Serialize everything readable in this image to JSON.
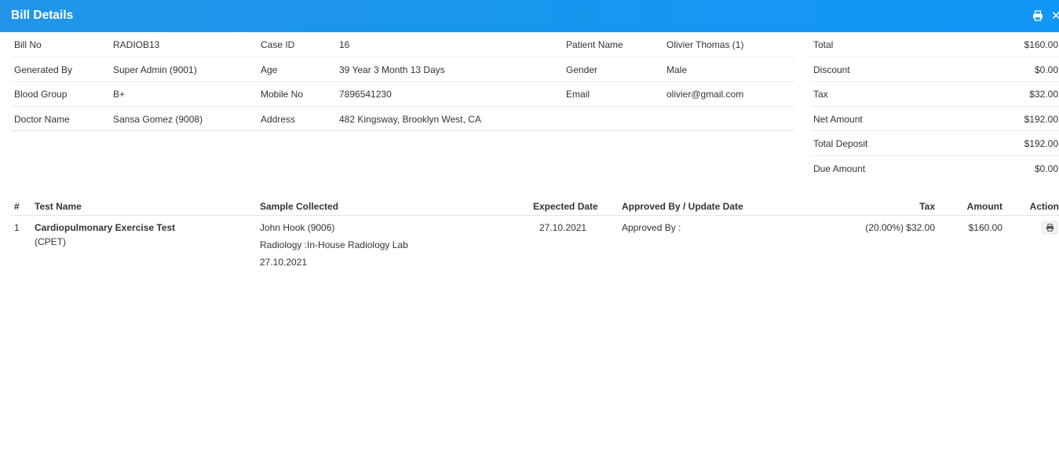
{
  "header": {
    "title": "Bill Details",
    "print_icon": "print-icon",
    "close_icon": "close-icon",
    "close_glyph": "✕"
  },
  "bill_info": {
    "rows": [
      [
        {
          "label": "Bill No",
          "value": "RADIOB13"
        },
        {
          "label": "Case ID",
          "value": "16"
        },
        {
          "label": "Patient Name",
          "value": "Olivier Thomas (1)"
        }
      ],
      [
        {
          "label": "Generated By",
          "value": "Super Admin (9001)"
        },
        {
          "label": "Age",
          "value": "39 Year 3 Month 13 Days"
        },
        {
          "label": "Gender",
          "value": "Male"
        }
      ],
      [
        {
          "label": "Blood Group",
          "value": "B+"
        },
        {
          "label": "Mobile No",
          "value": "7896541230"
        },
        {
          "label": "Email",
          "value": "olivier@gmail.com"
        }
      ],
      [
        {
          "label": "Doctor Name",
          "value": "Sansa Gomez (9008)"
        },
        {
          "label": "Address",
          "value": "482 Kingsway, Brooklyn West, CA"
        },
        {
          "label": "",
          "value": ""
        }
      ]
    ]
  },
  "summary": [
    {
      "label": "Total",
      "value": "$160.00"
    },
    {
      "label": "Discount",
      "value": "$0.00"
    },
    {
      "label": "Tax",
      "value": "$32.00"
    },
    {
      "label": "Net Amount",
      "value": "$192.00"
    },
    {
      "label": "Total Deposit",
      "value": "$192.00"
    },
    {
      "label": "Due Amount",
      "value": "$0.00"
    }
  ],
  "tests_table": {
    "headers": {
      "num": "#",
      "test_name": "Test Name",
      "sample_collected": "Sample Collected",
      "expected_date": "Expected Date",
      "approved_by": "Approved By / Update Date",
      "tax": "Tax",
      "amount": "Amount",
      "action": "Action"
    },
    "rows": [
      {
        "num": "1",
        "test_name": "Cardiopulmonary Exercise Test",
        "test_short": "(CPET)",
        "sample_by": "John Hook (9006)",
        "sample_lab": "Radiology :In-House Radiology Lab",
        "sample_date": "27.10.2021",
        "expected_date": "27.10.2021",
        "approved_by": "Approved By :",
        "tax": "(20.00%) $32.00",
        "amount": "$160.00",
        "action_icon": "print-icon"
      }
    ]
  },
  "colors": {
    "header_bg": "#1197f5",
    "header_text": "#ffffff",
    "text": "#333333",
    "divider": "#eeeeee"
  }
}
